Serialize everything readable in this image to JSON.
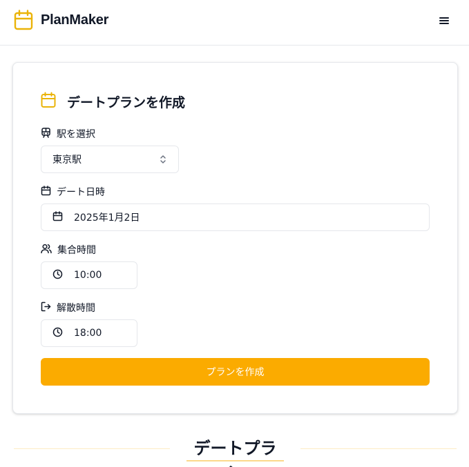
{
  "app": {
    "name": "PlanMaker",
    "brand_icon": "calendar-icon",
    "accent_color": "#fbab00"
  },
  "header": {
    "menu_icon": "hamburger-menu-icon"
  },
  "form": {
    "title": "デートプランを作成",
    "station": {
      "label": "駅を選択",
      "icon": "train-icon",
      "value": "東京駅"
    },
    "date": {
      "label": "デート日時",
      "icon": "calendar-icon",
      "value": "2025年1月2日"
    },
    "meet_time": {
      "label": "集合時間",
      "icon": "users-icon",
      "value": "10:00"
    },
    "end_time": {
      "label": "解散時間",
      "icon": "log-out-icon",
      "value": "18:00"
    },
    "submit_label": "プランを作成"
  },
  "plan_section": {
    "title": "デートプラン"
  }
}
